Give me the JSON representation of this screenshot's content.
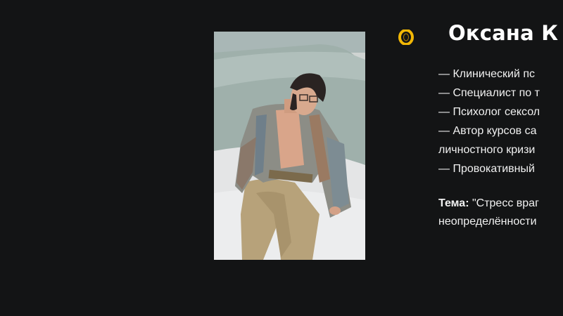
{
  "speaker": {
    "name": "Оксана К",
    "bio": [
      "— Клинический пс",
      "— Специалист по т",
      "— Психолог сексол",
      "— Автор курсов са",
      "личностного кризи",
      "— Провокативный"
    ],
    "topic_label": "Тема:",
    "topic_line1": "\"Стресс враг",
    "topic_line2": "неопределённости"
  },
  "colors": {
    "background": "#131415",
    "text": "#f1f1f1",
    "accent_icon": "#f2b705"
  },
  "icons": {
    "accent": "gold-ring-icon"
  }
}
